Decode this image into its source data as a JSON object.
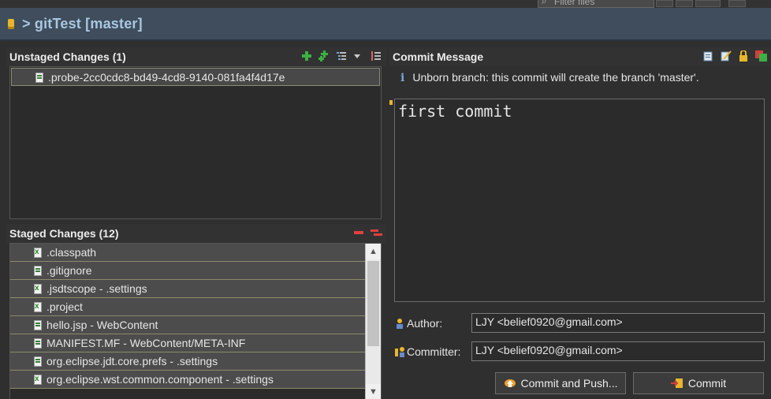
{
  "top": {
    "filter_placeholder": "Filter files"
  },
  "header": {
    "title": "> gitTest [master]"
  },
  "unstaged": {
    "title": "Unstaged Changes (1)",
    "items": [
      {
        "label": ".probe-2cc0cdc8-bd49-4cd8-9140-081fa4f4d17e"
      }
    ]
  },
  "staged": {
    "title": "Staged Changes (12)",
    "items": [
      {
        "label": ".classpath"
      },
      {
        "label": ".gitignore"
      },
      {
        "label": ".jsdtscope - .settings"
      },
      {
        "label": ".project"
      },
      {
        "label": "hello.jsp - WebContent"
      },
      {
        "label": "MANIFEST.MF - WebContent/META-INF"
      },
      {
        "label": "org.eclipse.jdt.core.prefs - .settings"
      },
      {
        "label": "org.eclipse.wst.common.component - .settings"
      }
    ]
  },
  "commit": {
    "title": "Commit Message",
    "info": "Unborn branch: this commit will create the branch 'master'.",
    "message": "first commit",
    "author_label": "Author:",
    "author_value": "LJY <belief0920@gmail.com>",
    "committer_label": "Committer:",
    "committer_value": "LJY <belief0920@gmail.com>",
    "commit_push_label": "Commit and Push...",
    "commit_label": "Commit"
  }
}
